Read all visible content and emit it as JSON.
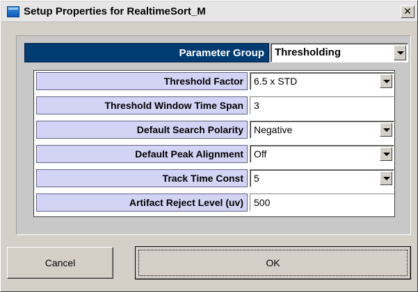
{
  "window": {
    "title": "Setup Properties for RealtimeSort_M",
    "close_glyph": "✕",
    "icon": "app-window-icon"
  },
  "parameter_group": {
    "label": "Parameter Group",
    "value": "Thresholding"
  },
  "parameters": [
    {
      "label": "Threshold Factor",
      "value": "6.5 x STD",
      "control": "dropdown"
    },
    {
      "label": "Threshold Window Time Span",
      "value": "3",
      "control": "text"
    },
    {
      "label": "Default Search Polarity",
      "value": "Negative",
      "control": "dropdown"
    },
    {
      "label": "Default Peak Alignment",
      "value": "Off",
      "control": "dropdown"
    },
    {
      "label": "Track Time Const",
      "value": "5",
      "control": "dropdown"
    },
    {
      "label": "Artifact Reject Level (uv)",
      "value": "500",
      "control": "text"
    }
  ],
  "buttons": {
    "cancel_label": "Cancel",
    "ok_label": "OK"
  },
  "colors": {
    "dialog_bg": "#d4d0c8",
    "group_label_bg": "#003b72",
    "param_label_bg": "#d3d3f5"
  }
}
